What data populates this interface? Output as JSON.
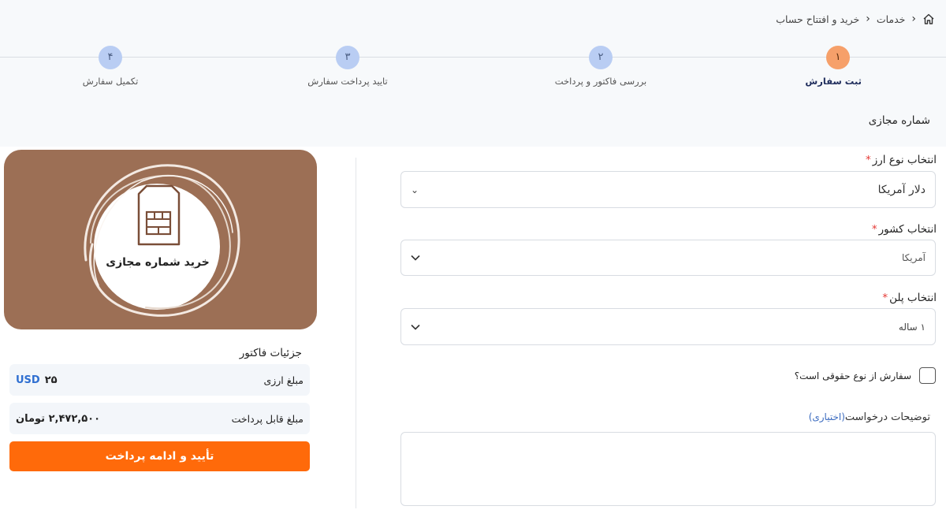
{
  "breadcrumb": {
    "items": [
      "خدمات",
      "خرید و افتتاح حساب"
    ]
  },
  "stepper": {
    "steps": [
      {
        "number": "۱",
        "label": "ثبت سفارش",
        "active": true
      },
      {
        "number": "۲",
        "label": "بررسی فاکتور و پرداخت",
        "active": false
      },
      {
        "number": "۳",
        "label": "تایید پرداخت سفارش",
        "active": false
      },
      {
        "number": "۴",
        "label": "تکمیل سفارش",
        "active": false
      }
    ]
  },
  "page": {
    "section_title": "شماره مجازی"
  },
  "form": {
    "currency": {
      "label": "انتخاب نوع ارز",
      "required_mark": "*",
      "value": "دلار آمریکا"
    },
    "country": {
      "label": "انتخاب کشور",
      "required_mark": "*",
      "value": "آمریکا"
    },
    "plan": {
      "label": "انتخاب پلن",
      "required_mark": "*",
      "value": "۱ ساله"
    },
    "legal_order": {
      "label": "سفارش از نوع حقوقی است؟",
      "checked": false
    },
    "description": {
      "label": "توضیحات درخواست",
      "optional": "(اختیاری)",
      "value": ""
    }
  },
  "banner": {
    "text": "خرید شماره مجازی",
    "icon": "sim-card-icon",
    "bg_color": "#9c6f55"
  },
  "invoice": {
    "title": "جزئیات فاکتور",
    "currency_amount": {
      "label": "مبلغ ارزی",
      "value": "۲۵",
      "currency": "USD"
    },
    "payable_amount": {
      "label": "مبلغ قابل پرداخت",
      "value": "۲,۴۷۲,۵۰۰ تومان"
    },
    "confirm_button": "تأیید و ادامه پرداخت"
  },
  "colors": {
    "accent": "#ff6a0a",
    "active_step": "#f6a06a",
    "inactive_step": "#b9cdf3"
  }
}
